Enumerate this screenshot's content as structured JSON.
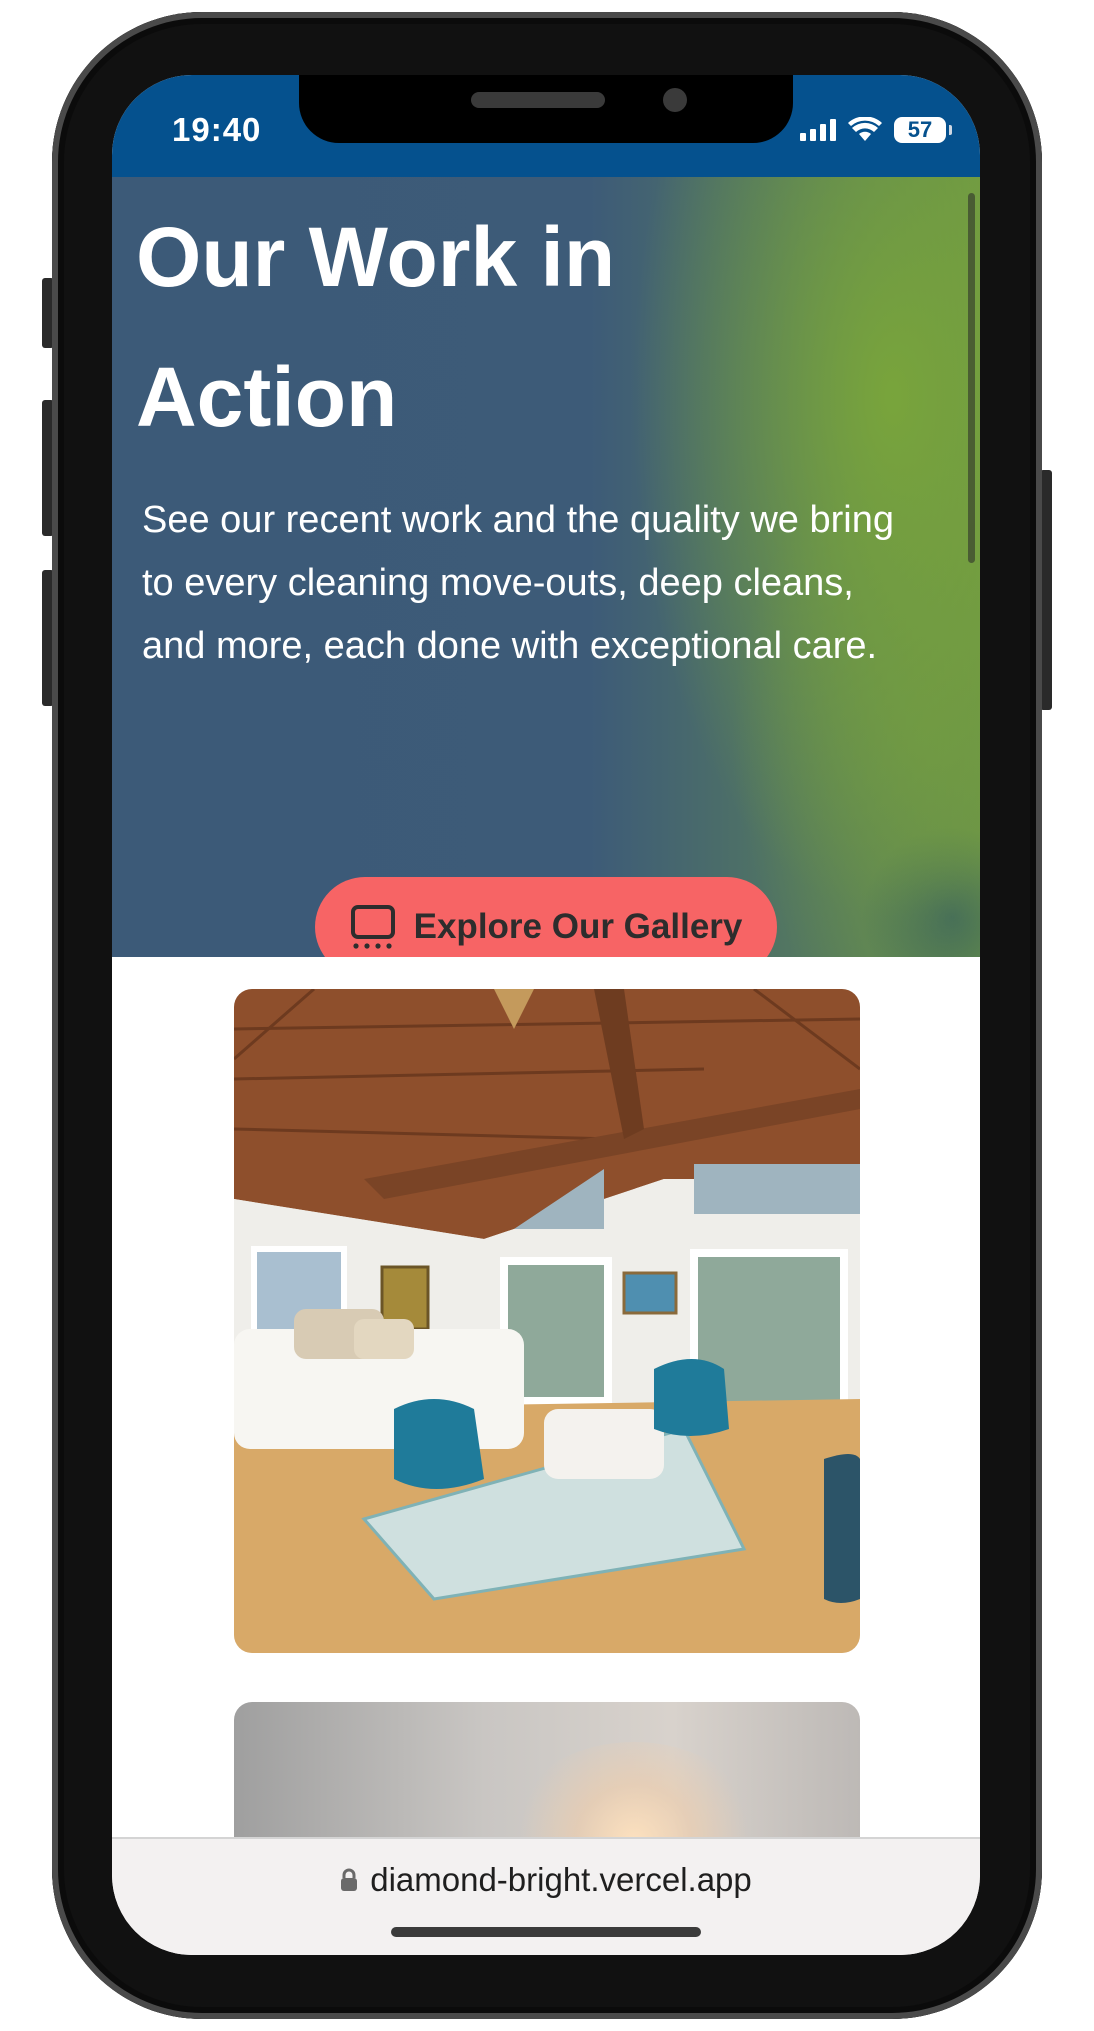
{
  "status_bar": {
    "time": "19:40",
    "battery": "57"
  },
  "hero": {
    "title": "Our Work in Action",
    "description": "See our recent work and the quality we bring to every cleaning move-outs, deep cleans, and more, each done with exceptional care.",
    "button_label": "Explore Our Gallery",
    "button_icon": "gallery-icon",
    "colors": {
      "base": "#3d5b78",
      "green_glow": "#7aa63a",
      "button": "#f76465",
      "status_bar": "#05518e"
    }
  },
  "gallery": {
    "images": [
      {
        "subject": "bedroom-photo"
      },
      {
        "subject": "room-photo"
      }
    ]
  },
  "browser": {
    "url": "diamond-bright.vercel.app",
    "lock_icon": "lock-icon"
  }
}
